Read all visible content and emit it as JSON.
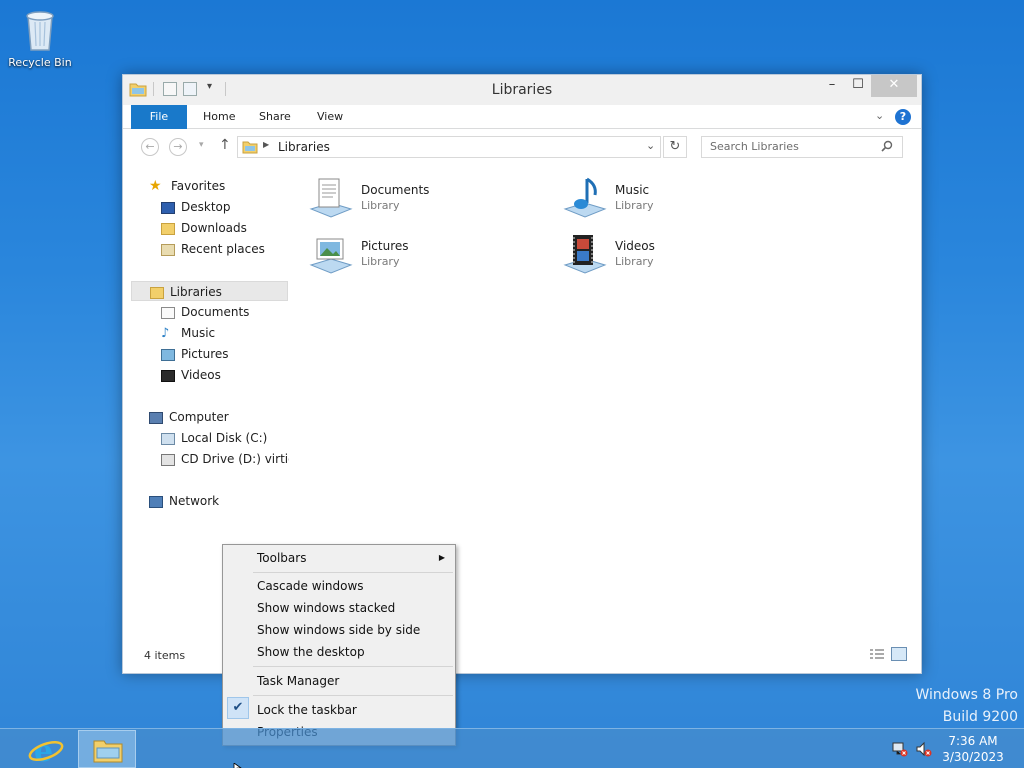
{
  "desktop": {
    "recycle_bin_label": "Recycle Bin",
    "watermark_line1": "Windows 8 Pro",
    "watermark_line2": "Build 9200"
  },
  "window": {
    "title": "Libraries",
    "controls": {
      "minimize": "–",
      "maximize": "☐",
      "close": "✕"
    },
    "ribbon_tabs": [
      "File",
      "Home",
      "Share",
      "View"
    ],
    "address": "Libraries",
    "search_placeholder": "Search Libraries",
    "status_text": "4 items"
  },
  "nav_pane": {
    "favorites": {
      "label": "Favorites",
      "items": [
        "Desktop",
        "Downloads",
        "Recent places"
      ]
    },
    "libraries": {
      "label": "Libraries",
      "items": [
        "Documents",
        "Music",
        "Pictures",
        "Videos"
      ]
    },
    "computer": {
      "label": "Computer",
      "items": [
        "Local Disk (C:)",
        "CD Drive (D:) virtio-w"
      ]
    },
    "network": {
      "label": "Network"
    }
  },
  "content_items": [
    {
      "name": "Documents",
      "type": "Library"
    },
    {
      "name": "Music",
      "type": "Library"
    },
    {
      "name": "Pictures",
      "type": "Library"
    },
    {
      "name": "Videos",
      "type": "Library"
    }
  ],
  "context_menu": {
    "toolbars": "Toolbars",
    "cascade": "Cascade windows",
    "stacked": "Show windows stacked",
    "side_by_side": "Show windows side by side",
    "show_desktop": "Show the desktop",
    "task_manager": "Task Manager",
    "lock_taskbar": "Lock the taskbar",
    "lock_checked": true,
    "properties": "Properties"
  },
  "taskbar": {
    "time": "7:36 AM",
    "date": "3/30/2023"
  },
  "colors": {
    "accent": "#1979ca",
    "help": "#1e73d2"
  }
}
